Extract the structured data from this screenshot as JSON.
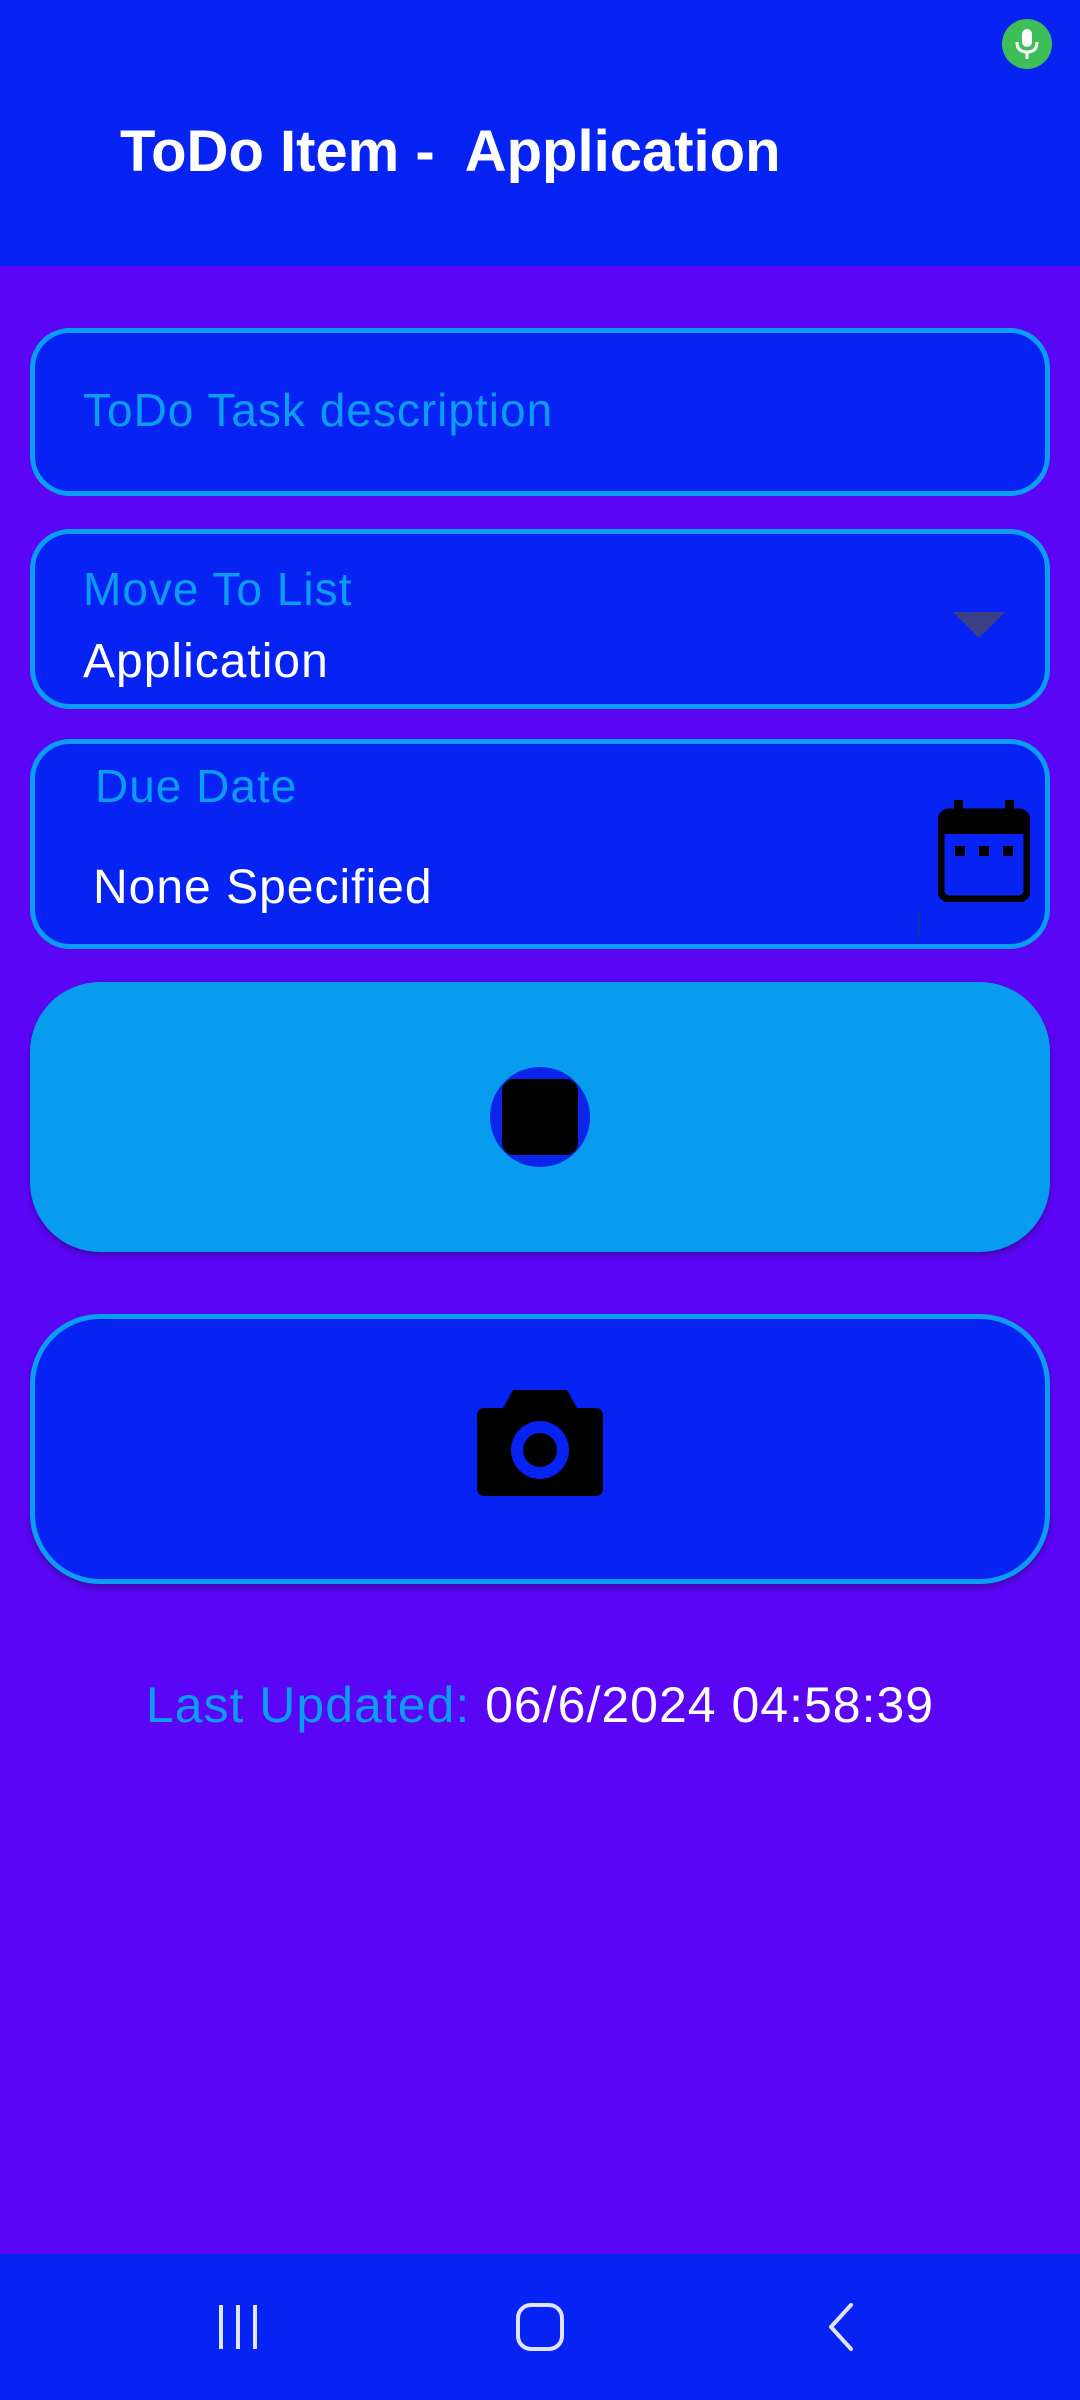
{
  "status_bar": {
    "mic_icon": "mic-icon",
    "mic_color": "#3DBE57"
  },
  "app_bar": {
    "title": "ToDo Item -  Application"
  },
  "form": {
    "task_description": {
      "placeholder": "ToDo Task description",
      "value": ""
    },
    "move_to_list": {
      "label": "Move To List",
      "value": "Application",
      "icon": "dropdown-arrow-icon"
    },
    "due_date": {
      "label": "Due Date",
      "value": "None Specified",
      "icon": "calendar-icon"
    },
    "record_button": {
      "icon": "stop-icon"
    },
    "camera_button": {
      "icon": "camera-icon"
    },
    "last_updated": {
      "label": "Last Updated:",
      "value": "06/6/2024 04:58:39"
    }
  },
  "nav_bar": {
    "items": [
      "recent-apps-icon",
      "home-icon",
      "back-icon"
    ]
  },
  "colors": {
    "background": "#5A06F4",
    "app_bar": "#0623F3",
    "accent": "#0A9DF2",
    "record_button": "#089CEE",
    "text": "#FFFFFF"
  }
}
